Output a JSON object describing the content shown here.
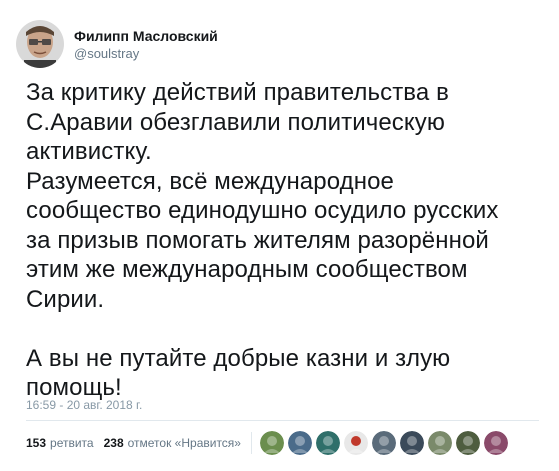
{
  "author": {
    "display_name": "Филипп Масловский",
    "handle": "@soulstray",
    "avatar_icon": "user-avatar"
  },
  "tweet": {
    "lines": [
      "За критику действий правительства в",
      "С.Аравии обезглавили политическую",
      "активистку.",
      "Разумеется, всё международное",
      "сообщество единодушно осудило русских",
      "за призыв помогать жителям разорённой",
      "этим же международным сообществом",
      "Сирии.",
      "",
      "А вы не путайте добрые казни и злую",
      "помощь!"
    ],
    "timestamp": "16:59 - 20 авг. 2018 г."
  },
  "stats": {
    "retweets_count": "153",
    "retweets_label": "ретвита",
    "likes_count": "238",
    "likes_label": "отметок «Нравится»"
  },
  "likers": [
    {
      "name": "liker-avatar-1",
      "color": "#6b8e4e"
    },
    {
      "name": "liker-avatar-2",
      "color": "#4a6b8a"
    },
    {
      "name": "liker-avatar-3",
      "color": "#2f6f6a"
    },
    {
      "name": "liker-avatar-4",
      "color": "#e8e8e8"
    },
    {
      "name": "liker-avatar-5",
      "color": "#5a6b7a"
    },
    {
      "name": "liker-avatar-6",
      "color": "#3b4a5a"
    },
    {
      "name": "liker-avatar-7",
      "color": "#7a8a6a"
    },
    {
      "name": "liker-avatar-8",
      "color": "#4e5d3f"
    },
    {
      "name": "liker-avatar-9",
      "color": "#8a4a6a"
    }
  ]
}
